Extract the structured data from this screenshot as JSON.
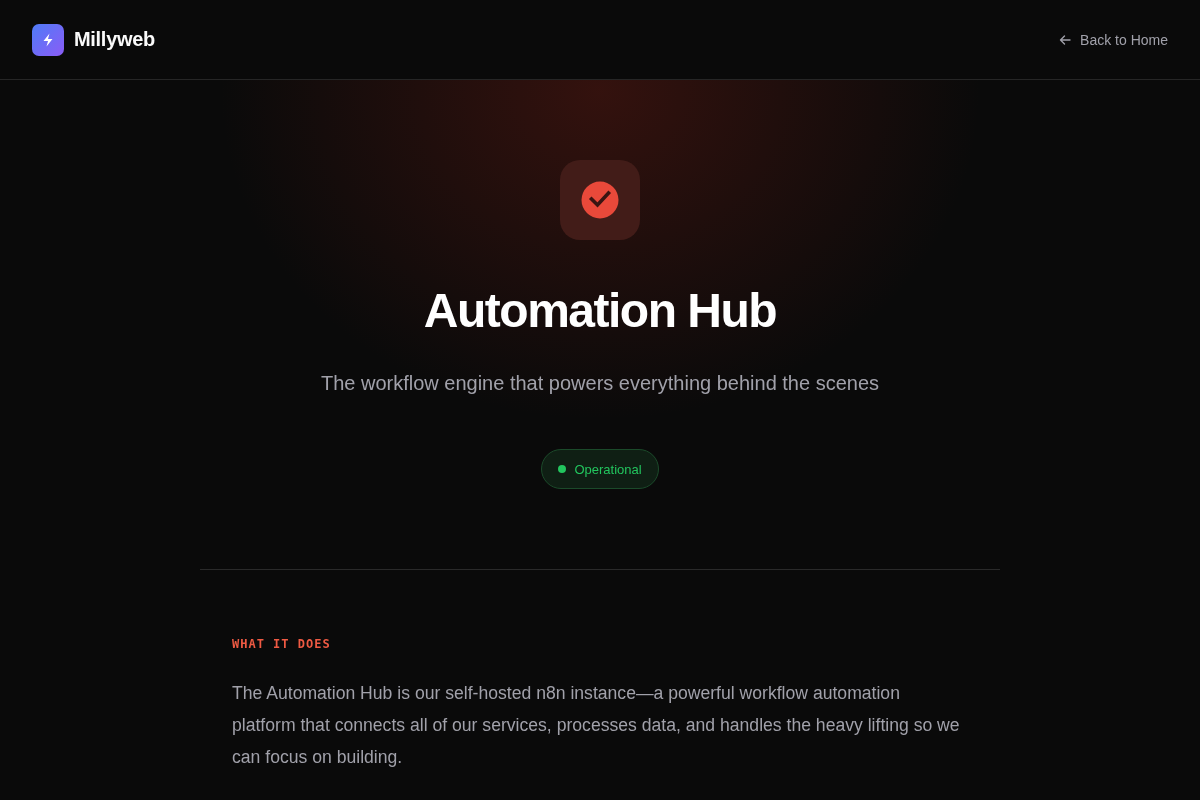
{
  "header": {
    "brand": "Millyweb",
    "back_link": "Back to Home"
  },
  "hero": {
    "title": "Automation Hub",
    "subtitle": "The workflow engine that powers everything behind the scenes",
    "status": {
      "label": "Operational",
      "operational": true
    }
  },
  "section": {
    "label": "WHAT IT DOES",
    "text": "The Automation Hub is our self-hosted n8n instance—a powerful workflow automation platform that connects all of our services, processes data, and handles the heavy lifting so we can focus on building."
  }
}
